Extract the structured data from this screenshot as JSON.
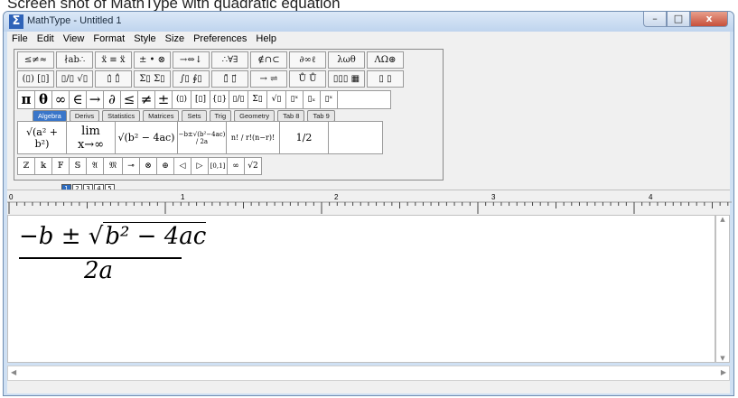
{
  "caption": "Screen shot of MathType with quadratic equation",
  "window": {
    "title": "MathType - Untitled 1",
    "buttons": {
      "minimize": "–",
      "maximize": "□",
      "close": "x"
    }
  },
  "menu": [
    "File",
    "Edit",
    "View",
    "Format",
    "Style",
    "Size",
    "Preferences",
    "Help"
  ],
  "symbol_palette_row1": [
    "≤≠≈",
    "∤ab∴",
    "ẍ ≡ ẍ",
    "± • ⊗",
    "→⇔↓",
    "∴∀∃",
    "∉∩⊂",
    "∂∞ℓ",
    "λωθ",
    "ΛΩ⊛"
  ],
  "symbol_palette_row2": [
    "(▯) [▯]",
    "▯/▯ √▯",
    "▯̇ ▯̂",
    "Σ▯ Σ▯",
    "∫▯ ∮▯",
    "▯̄ ▯⃗",
    "→ ⇌",
    "Ů Ů",
    "▯▯▯ ▦",
    "▯ ▯"
  ],
  "small_bar": [
    "π",
    "θ",
    "∞",
    "∈",
    "→",
    "∂",
    "≤",
    "≠",
    "±",
    "(▯)",
    "[▯]",
    "{▯}",
    "▯/▯",
    "Σ▯",
    "√▯",
    "▯ˣ",
    "▯ₓ",
    "▯ˣ"
  ],
  "tabs": [
    "Algebra",
    "Derivs",
    "Statistics",
    "Matrices",
    "Sets",
    "Trig",
    "Geometry",
    "Tab 8",
    "Tab 9"
  ],
  "active_tab": "Algebra",
  "templates": [
    "√(a² + b²)",
    "lim x→∞",
    "√(b² − 4ac)",
    "−b±√(b²−4ac) / 2a",
    "n! / r!(n−r)!",
    "1/2"
  ],
  "small_bar2": [
    "ℤ",
    "𝕜",
    "𝔽",
    "𝕊",
    "𝔄",
    "𝔐",
    "⊸",
    "⊗",
    "⊕",
    "◁",
    "▷",
    "[0,1]",
    "∞",
    "√2"
  ],
  "tab_selector": [
    "1",
    "2",
    "3",
    "4",
    "5"
  ],
  "ruler_labels": [
    "0",
    "1",
    "2",
    "3",
    "4"
  ],
  "equation": {
    "numerator_prefix": "−b ± ",
    "radicand": "b² − 4ac",
    "denominator": "2a"
  }
}
